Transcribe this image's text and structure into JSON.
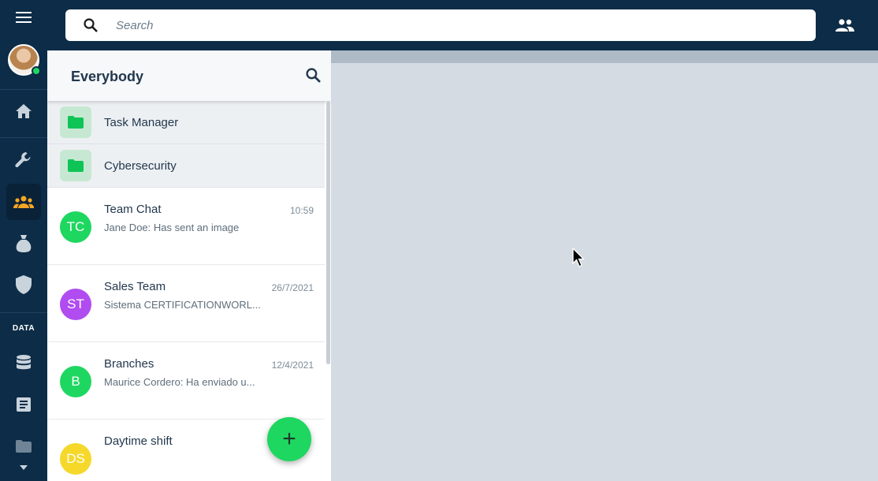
{
  "search": {
    "placeholder": "Search"
  },
  "rail": {
    "section_label": "DATA",
    "items": [
      {
        "icon": "menu-icon"
      },
      {
        "icon": "home-icon"
      },
      {
        "icon": "wrench-icon"
      },
      {
        "icon": "groups-icon",
        "active": true
      },
      {
        "icon": "money-bag-icon"
      },
      {
        "icon": "shield-icon"
      },
      {
        "icon": "database-icon"
      },
      {
        "icon": "article-icon"
      },
      {
        "icon": "folder-icon"
      },
      {
        "icon": "chevron-down-icon"
      }
    ]
  },
  "panel": {
    "title": "Everybody",
    "folders": [
      {
        "label": "Task Manager"
      },
      {
        "label": "Cybersecurity"
      }
    ],
    "chats": [
      {
        "initials": "TC",
        "name": "Team Chat",
        "time": "10:59",
        "preview": "Jane Doe: Has sent an image",
        "color": "#1ed760"
      },
      {
        "initials": "ST",
        "name": "Sales Team",
        "time": "26/7/2021",
        "preview": "Sistema CERTIFICATIONWORL...",
        "color": "#b04cf0"
      },
      {
        "initials": "B",
        "name": "Branches",
        "time": "12/4/2021",
        "preview": "Maurice Cordero: Ha enviado u...",
        "color": "#1ed760"
      },
      {
        "initials": "DS",
        "name": "Daytime shift",
        "time": "",
        "preview": "",
        "color": "#f5d82a"
      }
    ],
    "fab_label": "+"
  },
  "colors": {
    "rail_bg": "#0c2c47",
    "accent_green": "#1ed760",
    "content_bg": "#d4dbe3",
    "rail_active_icon": "#f5a623"
  }
}
